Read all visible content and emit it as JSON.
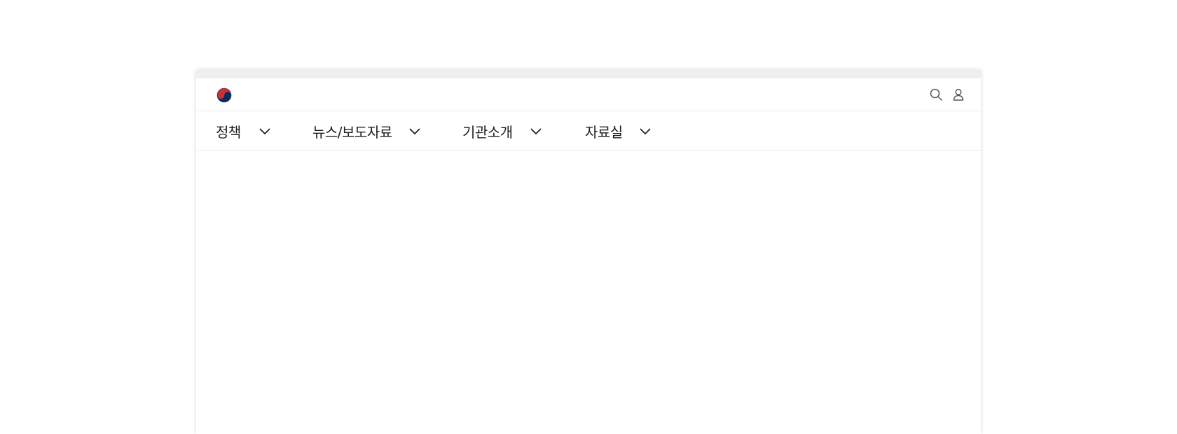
{
  "header": {
    "logo_icon": "korea-government-taegeuk-logo",
    "utility_icons": [
      "search-icon",
      "user-icon"
    ]
  },
  "nav": {
    "items": [
      {
        "label": "정책"
      },
      {
        "label": "뉴스/보도자료"
      },
      {
        "label": "기관소개"
      },
      {
        "label": "자료실"
      }
    ]
  },
  "colors": {
    "logo_red": "#cd2e3a",
    "logo_blue": "#0f2a5c",
    "top_strip": "#efefef",
    "text": "#1e1e1e"
  }
}
